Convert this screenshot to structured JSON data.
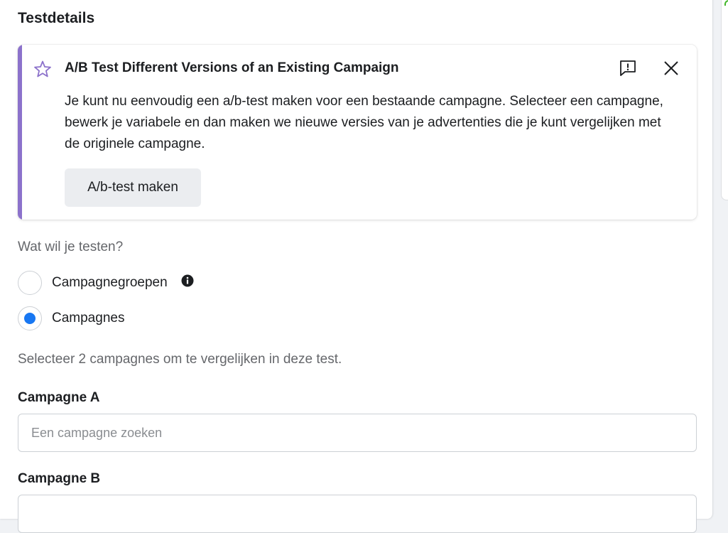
{
  "page": {
    "title": "Testdetails"
  },
  "notice": {
    "title": "A/B Test Different Versions of an Existing Campaign",
    "body": "Je kunt nu eenvoudig een a/b-test maken voor een bestaande campagne. Selecteer een campagne, bewerk je variabele en dan maken we nieuwe versies van je advertenties die je kunt vergelijken met de originele campagne.",
    "button_label": "A/b-test maken",
    "icons": [
      "star-icon",
      "report-icon",
      "close-icon"
    ],
    "accent_color": "#8c72cb"
  },
  "test_type": {
    "question": "Wat wil je testen?",
    "options": [
      {
        "label": "Campagnegroepen",
        "selected": false,
        "has_info_icon": true
      },
      {
        "label": "Campagnes",
        "selected": true,
        "has_info_icon": false
      }
    ],
    "selected_color": "#1877f2"
  },
  "campaign_selection": {
    "helper": "Selecteer 2 campagnes om te vergelijken in deze test.",
    "campaign_a": {
      "label": "Campagne A",
      "placeholder": "Een campagne zoeken",
      "value": ""
    },
    "campaign_b": {
      "label": "Campagne B",
      "placeholder": "",
      "value": ""
    }
  }
}
